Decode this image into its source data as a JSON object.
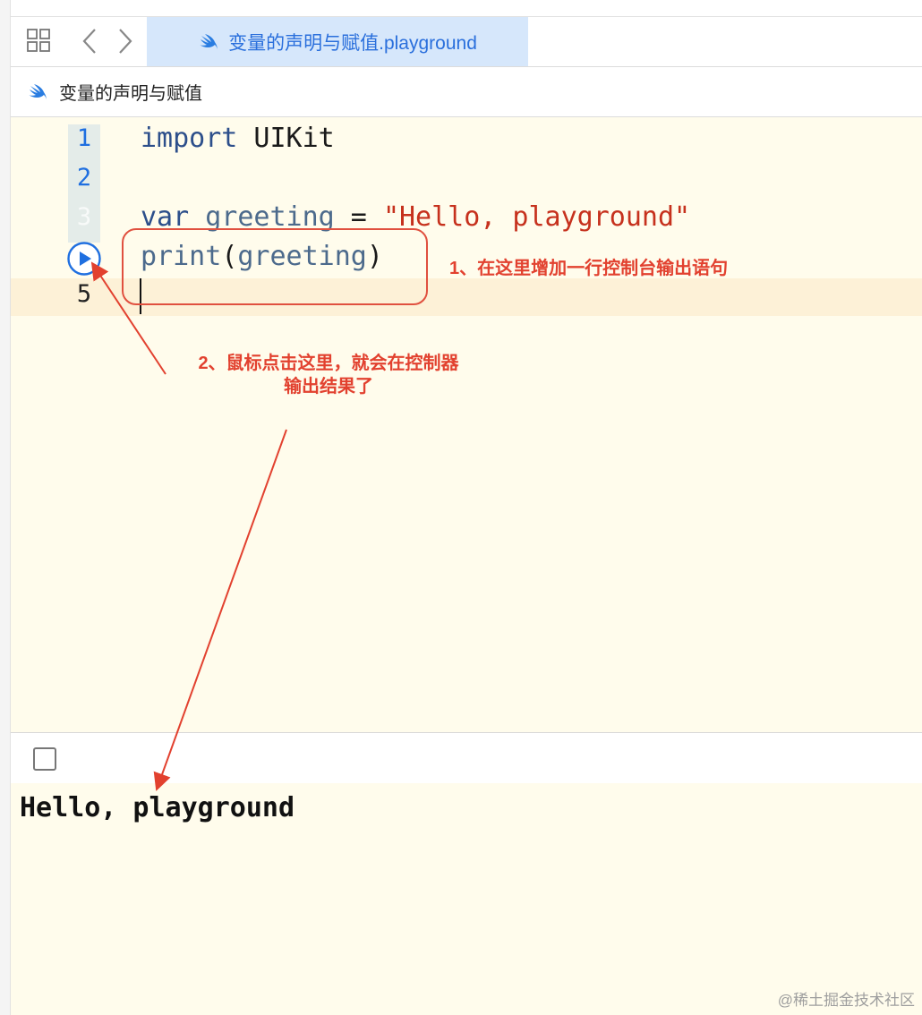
{
  "tab": {
    "title": "变量的声明与赋值.playground"
  },
  "breadcrumb": {
    "title": "变量的声明与赋值"
  },
  "editor": {
    "line_numbers": [
      "1",
      "2",
      "3",
      "5"
    ],
    "lines": {
      "l1": {
        "kw": "import",
        "rest": " UIKit"
      },
      "l3": {
        "kw": "var",
        "sp": " ",
        "ident": "greeting",
        "eq": " = ",
        "str": "\"Hello, playground\""
      },
      "l4": {
        "fn": "print",
        "open": "(",
        "arg": "greeting",
        "close": ")"
      }
    }
  },
  "annotations": {
    "note1": "1、在这里增加一行控制台输出语句",
    "note2_line1": "2、鼠标点击这里，就会在控制器",
    "note2_line2": "输出结果了",
    "color": "#e2412f"
  },
  "console": {
    "output": "Hello, playground"
  },
  "watermark": "@稀土掘金技术社区",
  "colors": {
    "accent": "#1f6fe0",
    "editor_bg": "#fffcec",
    "tab_bg": "#d6e7fb"
  },
  "icons": [
    "grid-icon",
    "chevron-left-icon",
    "chevron-right-icon",
    "swift-icon",
    "play-icon"
  ]
}
